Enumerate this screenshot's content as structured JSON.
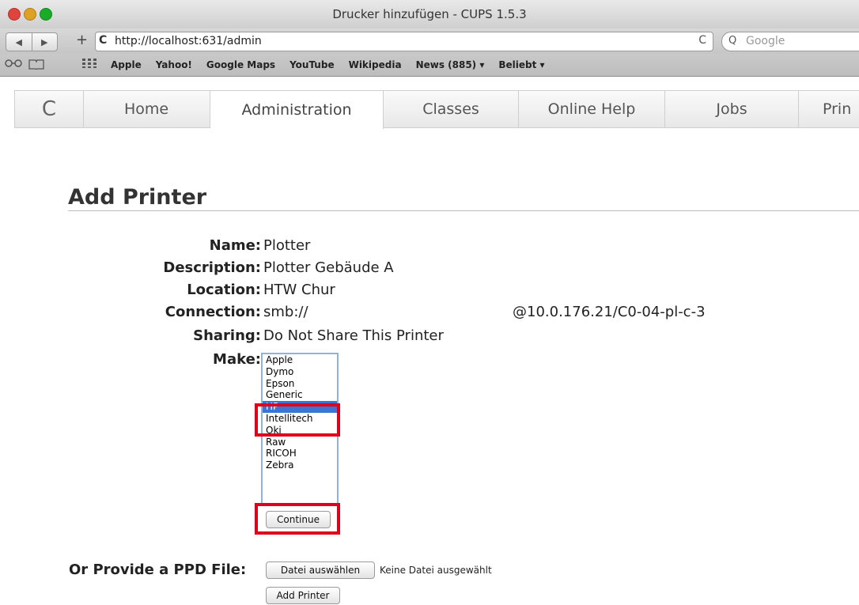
{
  "window": {
    "title": "Drucker hinzufügen - CUPS 1.5.3"
  },
  "toolbar": {
    "new_tab": "+",
    "url_icon": "C",
    "url": "http://localhost:631/admin",
    "reload": "C",
    "search_icon": "Q",
    "search_placeholder": "Google"
  },
  "bookmarks": [
    "Apple",
    "Yahoo!",
    "Google Maps",
    "YouTube",
    "Wikipedia",
    "News (885) ▾",
    "Beliebt ▾"
  ],
  "cups_nav": {
    "logo": "C",
    "tabs": [
      "Home",
      "Administration",
      "Classes",
      "Online Help",
      "Jobs",
      "Prin"
    ],
    "active_tab": "Administration"
  },
  "page": {
    "heading": "Add Printer",
    "fields": {
      "name": {
        "label": "Name:",
        "value": "Plotter"
      },
      "description": {
        "label": "Description:",
        "value": "Plotter Gebäude A"
      },
      "location": {
        "label": "Location:",
        "value": "HTW Chur"
      },
      "connection": {
        "label": "Connection:",
        "value": "smb://",
        "host": "@10.0.176.21/C0-04-pl-c-3"
      },
      "sharing": {
        "label": "Sharing:",
        "value": "Do Not Share This Printer"
      },
      "make": {
        "label": "Make:"
      }
    },
    "make_options": [
      "Apple",
      "Dymo",
      "Epson",
      "Generic",
      "HP",
      "Intellitech",
      "Oki",
      "Raw",
      "RICOH",
      "Zebra"
    ],
    "make_selected": "HP",
    "continue_label": "Continue",
    "ppd_label": "Or Provide a PPD File:",
    "choose_file_label": "Datei auswählen",
    "no_file_text": "Keine Datei ausgewählt",
    "add_printer_label": "Add Printer"
  },
  "colors": {
    "highlight": "#e0001a",
    "selection": "#3875d7"
  }
}
